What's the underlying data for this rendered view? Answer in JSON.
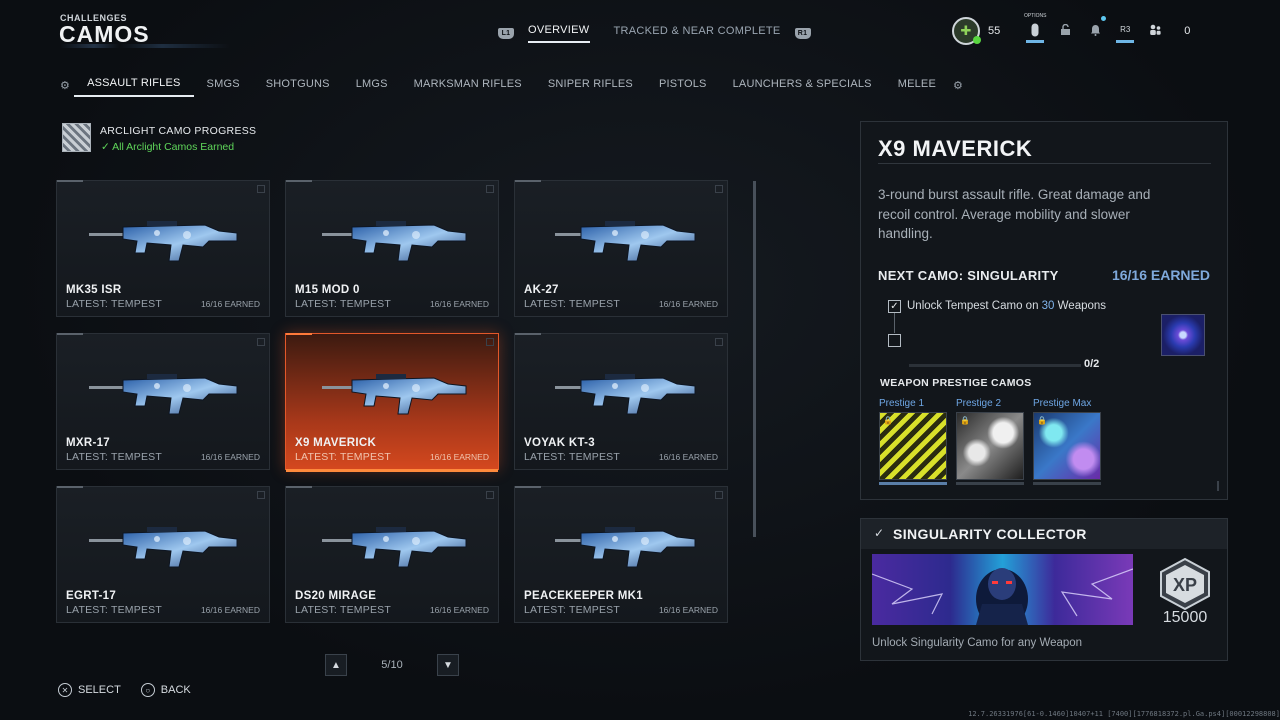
{
  "header": {
    "section_label": "CHALLENGES",
    "title": "CAMOS",
    "left_bumper": "L1",
    "right_bumper": "R1",
    "tabs": [
      {
        "label": "OVERVIEW",
        "active": true
      },
      {
        "label": "TRACKED & NEAR COMPLETE",
        "active": false
      }
    ]
  },
  "status_bar": {
    "level": "55",
    "options_label": "OPTIONS",
    "r3_label": "R3",
    "party_count": "0",
    "icons": [
      "player-emblem-icon",
      "options-icon",
      "lock-icon",
      "bell-icon",
      "r3-icon",
      "party-icon"
    ]
  },
  "categories": [
    {
      "label": "ASSAULT RIFLES",
      "active": true
    },
    {
      "label": "SMGS"
    },
    {
      "label": "SHOTGUNS"
    },
    {
      "label": "LMGS"
    },
    {
      "label": "MARKSMAN RIFLES"
    },
    {
      "label": "SNIPER RIFLES"
    },
    {
      "label": "PISTOLS"
    },
    {
      "label": "LAUNCHERS & SPECIALS"
    },
    {
      "label": "MELEE"
    }
  ],
  "arclight": {
    "title": "ARCLIGHT CAMO PROGRESS",
    "status": "All Arclight Camos Earned",
    "status_color": "#5fd65a"
  },
  "weapons": [
    {
      "name": "MK35 ISR",
      "latest": "LATEST: TEMPEST",
      "earned": "16/16 EARNED"
    },
    {
      "name": "M15 MOD 0",
      "latest": "LATEST: TEMPEST",
      "earned": "16/16 EARNED"
    },
    {
      "name": "AK-27",
      "latest": "LATEST: TEMPEST",
      "earned": "16/16 EARNED"
    },
    {
      "name": "MXR-17",
      "latest": "LATEST: TEMPEST",
      "earned": "16/16 EARNED"
    },
    {
      "name": "X9 MAVERICK",
      "latest": "LATEST: TEMPEST",
      "earned": "16/16 EARNED",
      "selected": true
    },
    {
      "name": "VOYAK KT-3",
      "latest": "LATEST: TEMPEST",
      "earned": "16/16 EARNED"
    },
    {
      "name": "EGRT-17",
      "latest": "LATEST: TEMPEST",
      "earned": "16/16 EARNED"
    },
    {
      "name": "DS20 MIRAGE",
      "latest": "LATEST: TEMPEST",
      "earned": "16/16 EARNED"
    },
    {
      "name": "PEACEKEEPER MK1",
      "latest": "LATEST: TEMPEST",
      "earned": "16/16 EARNED"
    }
  ],
  "pager": {
    "page": "5/10"
  },
  "footer": {
    "select_label": "SELECT",
    "back_label": "BACK",
    "build": "12.7.26331976[61-0.1460]10407+11 [7400][1776818372.pl.Ga.ps4][00012298808]"
  },
  "detail": {
    "title": "X9 MAVERICK",
    "description": "3-round burst assault rifle. Great damage and recoil control. Average mobility and slower handling.",
    "next_camo": "NEXT CAMO: SINGULARITY",
    "earned": "16/16 EARNED",
    "challenge_pre": "Unlock Tempest Camo on ",
    "challenge_count": "30",
    "challenge_post": " Weapons",
    "progress_text": "0/2",
    "progress": 0,
    "prestige_header": "WEAPON PRESTIGE CAMOS",
    "prestige": [
      {
        "label": "Prestige 1"
      },
      {
        "label": "Prestige 2"
      },
      {
        "label": "Prestige Max"
      }
    ]
  },
  "collector": {
    "title": "SINGULARITY COLLECTOR",
    "xp_label": "XP",
    "xp": "15000",
    "description": "Unlock Singularity Camo for any Weapon"
  },
  "colors": {
    "accent_blue": "#7fa9dc",
    "selected_orange": "#d4481e",
    "complete_green": "#5fd65a"
  }
}
